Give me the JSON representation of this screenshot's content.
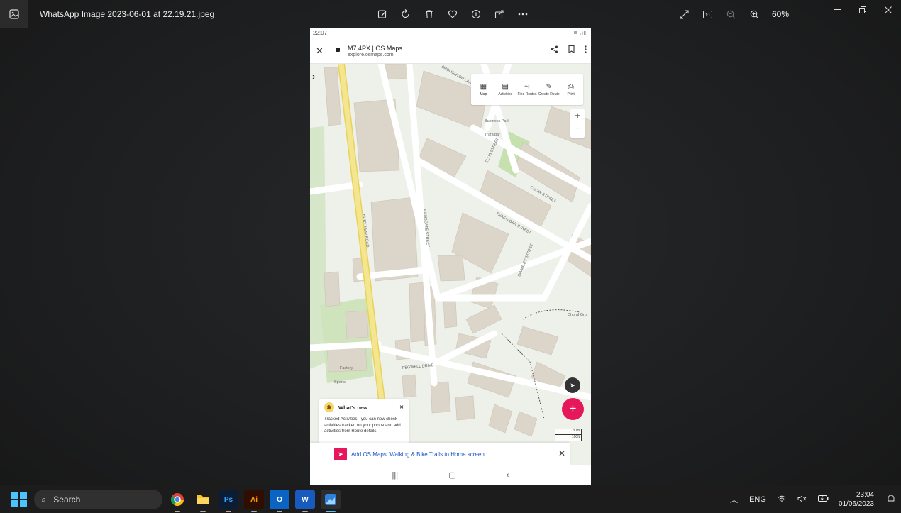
{
  "window": {
    "title": "WhatsApp Image 2023-06-01 at 22.19.21.jpeg",
    "zoom": "60%"
  },
  "phone": {
    "status_time": "22:07",
    "browser": {
      "title": "M7 4PX | OS Maps",
      "url": "explore.osmaps.com"
    },
    "map_tools": [
      {
        "label": "Map",
        "icon": "map-icon"
      },
      {
        "label": "Activities",
        "icon": "activities-icon"
      },
      {
        "label": "Find Routes",
        "icon": "find-routes-icon"
      },
      {
        "label": "Create Route",
        "icon": "create-route-icon"
      },
      {
        "label": "Print",
        "icon": "print-icon"
      }
    ],
    "street_labels": [
      "BURY NEW ROAD",
      "RAMSGATE STREET",
      "TRAFALGAR STREET",
      "CHOIR STREET",
      "ELLIS STREET",
      "BROUGHTON LANE",
      "PEGWELL DRIVE",
      "BRAMLEY STREET",
      "Business Park",
      "Trafalgar",
      "Choral Gro",
      "Sports",
      "Factory"
    ],
    "scale": {
      "metric": "30m",
      "imperial": "100ft"
    },
    "whats_new": {
      "title": "What's new:",
      "body": "Tracked Activities - you can now check activities tracked on your phone and add activities from Route details."
    },
    "install_banner": "Add OS Maps: Walking & Bike Trails to Home screen"
  },
  "taskbar": {
    "search_placeholder": "Search",
    "apps": [
      "chrome",
      "file-explorer",
      "photoshop",
      "illustrator",
      "outlook",
      "word",
      "photos"
    ],
    "language": "ENG",
    "time": "23:04",
    "date": "01/06/2023"
  },
  "colors": {
    "accent_pink": "#e4185b",
    "main_road": "#f2e27a",
    "building": "#d8d2c6",
    "green": "#cfe3bd"
  }
}
